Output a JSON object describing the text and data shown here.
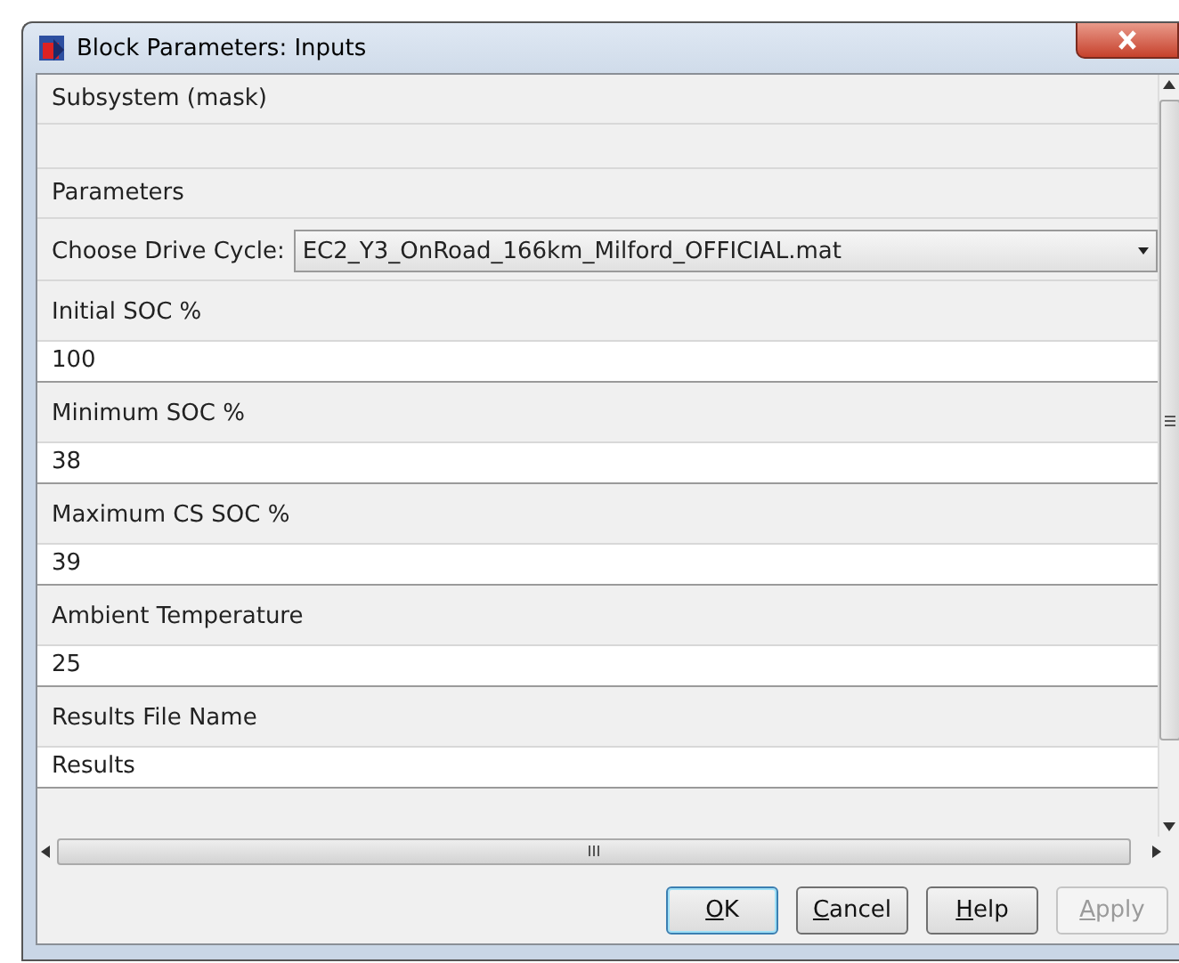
{
  "window": {
    "title": "Block Parameters: Inputs"
  },
  "section": "Subsystem (mask)",
  "group": "Parameters",
  "dropdown": {
    "label": "Choose Drive Cycle:",
    "value": "EC2_Y3_OnRoad_166km_Milford_OFFICIAL.mat"
  },
  "fields": [
    {
      "label": "Initial SOC %",
      "value": "100"
    },
    {
      "label": "Minimum SOC %",
      "value": "38"
    },
    {
      "label": "Maximum CS SOC %",
      "value": "39"
    },
    {
      "label": "Ambient Temperature",
      "value": "25"
    },
    {
      "label": "Results File Name",
      "value": "Results"
    }
  ],
  "buttons": [
    {
      "label": "OK",
      "mnemonic": true,
      "default": true,
      "disabled": false
    },
    {
      "label": "Cancel",
      "mnemonic": true,
      "default": false,
      "disabled": false
    },
    {
      "label": "Help",
      "mnemonic": true,
      "default": false,
      "disabled": false
    },
    {
      "label": "Apply",
      "mnemonic": true,
      "default": false,
      "disabled": true
    }
  ]
}
